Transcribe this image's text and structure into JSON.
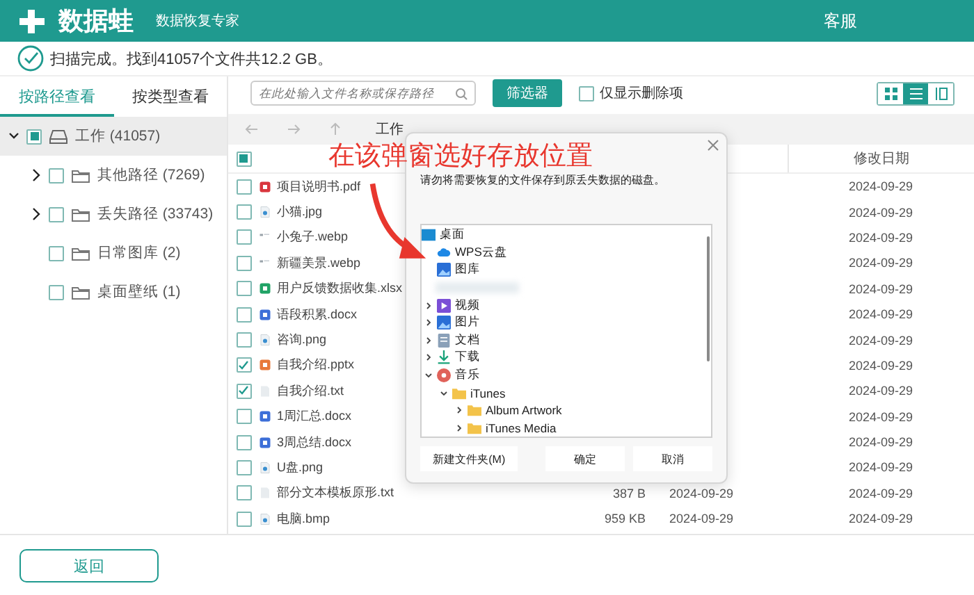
{
  "header": {
    "brand": "数据蛙",
    "subtitle": "数据恢复专家",
    "service": "客服"
  },
  "status": {
    "message": "扫描完成。找到41057个文件共12.2 GB。"
  },
  "sidebar": {
    "tabs": [
      {
        "label": "按路径查看",
        "selected": true
      },
      {
        "label": "按类型查看",
        "selected": false
      }
    ],
    "tree": [
      {
        "label": "工作 (41057)",
        "kind": "drive",
        "expanded": true,
        "checked": true,
        "selected": true,
        "children": [
          {
            "label": "其他路径 (7269)",
            "kind": "folder",
            "expanded": false,
            "checked": false,
            "selected": false
          },
          {
            "label": "丢失路径 (33743)",
            "kind": "folder",
            "expanded": false,
            "checked": false,
            "selected": false
          },
          {
            "label": "日常图库 (2)",
            "kind": "folder",
            "checked": false,
            "selected": false
          },
          {
            "label": "桌面壁纸 (1)",
            "kind": "folder",
            "checked": false,
            "selected": false
          }
        ]
      }
    ]
  },
  "toolbar": {
    "search": {
      "placeholder": "在此处输入文件名称或保存路径"
    },
    "filter_button": "筛选器",
    "deleted_only": {
      "label": "仅显示删除项",
      "checked": false
    },
    "views": [
      {
        "kind": "grid",
        "selected": false
      },
      {
        "kind": "list",
        "selected": true
      },
      {
        "kind": "preview",
        "selected": false
      }
    ]
  },
  "path": {
    "current": "工作"
  },
  "table": {
    "all_checked": true,
    "columns": [
      {
        "label": "修改日期"
      }
    ],
    "rows": [
      {
        "checked": false,
        "kind": "pdf",
        "name": "项目说明书.pdf",
        "modified": "2024-09-29"
      },
      {
        "checked": false,
        "kind": "image",
        "name": "小猫.jpg",
        "modified": "2024-09-29"
      },
      {
        "checked": false,
        "kind": "webp",
        "name": "小兔子.webp",
        "modified": "2024-09-29"
      },
      {
        "checked": false,
        "kind": "webp",
        "name": "新疆美景.webp",
        "modified": "2024-09-29"
      },
      {
        "checked": false,
        "kind": "xlsx",
        "name": "用户反馈数据收集.xlsx",
        "modified": "2024-09-29"
      },
      {
        "checked": false,
        "kind": "docx",
        "name": "语段积累.docx",
        "modified": "2024-09-29"
      },
      {
        "checked": false,
        "kind": "image",
        "name": "咨询.png",
        "modified": "2024-09-29"
      },
      {
        "checked": true,
        "kind": "pptx",
        "name": "自我介绍.pptx",
        "modified": "2024-09-29"
      },
      {
        "checked": true,
        "kind": "txt",
        "name": "自我介绍.txt",
        "modified": "2024-09-29"
      },
      {
        "checked": false,
        "kind": "docx",
        "name": "1周汇总.docx",
        "modified": "2024-09-29"
      },
      {
        "checked": false,
        "kind": "docx",
        "name": "3周总结.docx",
        "modified": "2024-09-29"
      },
      {
        "checked": false,
        "kind": "image",
        "name": "U盘.png",
        "modified": "2024-09-29"
      },
      {
        "checked": false,
        "kind": "txt",
        "name": "部分文本模板原形.txt",
        "size": "387  B",
        "created": "2024-09-29",
        "modified": "2024-09-29"
      },
      {
        "checked": false,
        "kind": "image",
        "name": "电脑.bmp",
        "size": "959 KB",
        "created": "2024-09-29",
        "modified": "2024-09-29"
      }
    ]
  },
  "dialog": {
    "message": "请勿将需要恢复的文件保存到原丢失数据的磁盘。",
    "tree": [
      {
        "label": "桌面",
        "kind": "desktop",
        "children": [
          {
            "label": "WPS云盘",
            "kind": "cloud"
          },
          {
            "label": "图库",
            "kind": "gallery"
          },
          {
            "kind": "blurred"
          },
          {
            "label": "视频",
            "kind": "video",
            "expanded": false
          },
          {
            "label": "图片",
            "kind": "pictures",
            "expanded": false
          },
          {
            "label": "文档",
            "kind": "documents",
            "expanded": false
          },
          {
            "label": "下载",
            "kind": "download",
            "expanded": false
          },
          {
            "label": "音乐",
            "kind": "music",
            "expanded": true,
            "children": [
              {
                "label": "iTunes",
                "kind": "folder",
                "expanded": true,
                "children": [
                  {
                    "label": "Album Artwork",
                    "kind": "folder",
                    "expanded": false
                  },
                  {
                    "label": "iTunes Media",
                    "kind": "folder",
                    "expanded": false
                  }
                ]
              }
            ]
          }
        ]
      }
    ],
    "buttons": [
      "新建文件夹(M)",
      "确定",
      "取消"
    ]
  },
  "annotation": {
    "text": "在该弹窗选好存放位置"
  },
  "footer": {
    "back_button": "返回"
  }
}
